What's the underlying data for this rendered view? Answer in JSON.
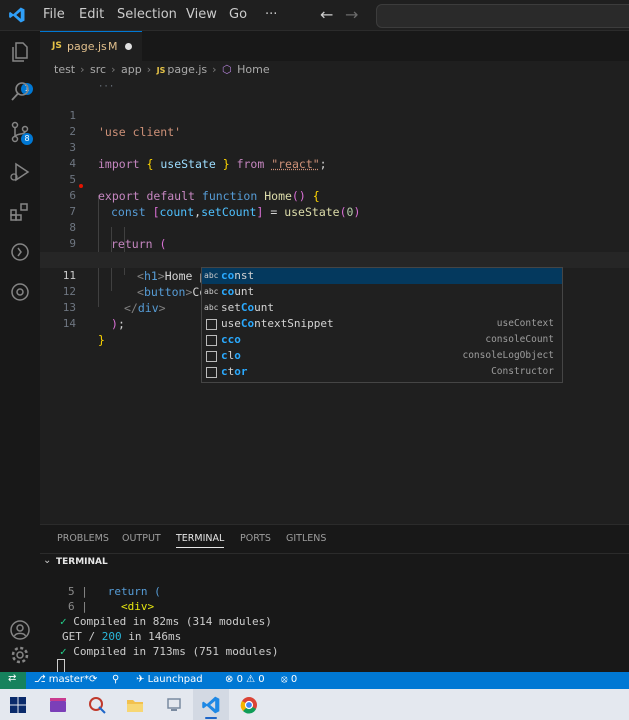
{
  "menu": [
    "File",
    "Edit",
    "Selection",
    "View",
    "Go",
    "···"
  ],
  "nav": {
    "back": "←",
    "forward": "→"
  },
  "activity_bar": {
    "scm_badge": "8",
    "explorer_badge": "1"
  },
  "tab": {
    "icon": "JS",
    "name": "page.js",
    "status": "M"
  },
  "breadcrumb": [
    "test",
    "src",
    "app",
    "page.js",
    "Home"
  ],
  "breadcrumb_icons": {
    "file": "JS",
    "symbol": "⬡"
  },
  "editor": {
    "scroll_hint": "···",
    "line_numbers": [
      "1",
      "2",
      "3",
      "4",
      "5",
      "6",
      "7",
      "8",
      "9",
      "10",
      "11",
      "12",
      "13",
      "14"
    ],
    "active_line": "11",
    "lines": {
      "l1": "'use client'",
      "l3": [
        "import",
        "{",
        "useState",
        "}",
        "from",
        "\"react\"",
        ";"
      ],
      "l5": [
        "export",
        "default",
        "function",
        "Home",
        "()",
        "{"
      ],
      "l6": [
        "const",
        "[",
        "count",
        ",",
        "setCount",
        "]",
        "=",
        "useState",
        "(",
        "0",
        ")"
      ],
      "l8": [
        "return",
        "("
      ],
      "l9": [
        "<",
        "div",
        ">"
      ],
      "l10": [
        "<",
        "h1",
        ">",
        "Home page",
        "</",
        "h1",
        ">"
      ],
      "l11": [
        "<",
        "button",
        ">",
        "Co",
        "</",
        "button",
        ">"
      ],
      "l12": [
        "</",
        "div",
        ">"
      ],
      "l13": [
        ")",
        ";"
      ],
      "l14": [
        "}"
      ]
    }
  },
  "suggestions": [
    {
      "kind": "abc",
      "match": "co",
      "rest": "nst",
      "detail": ""
    },
    {
      "kind": "abc",
      "match": "co",
      "rest": "unt",
      "detail": ""
    },
    {
      "kind": "abc",
      "pre": "set",
      "match": "Co",
      "rest": "unt",
      "detail": ""
    },
    {
      "kind": "snippet",
      "pre": "use",
      "match": "Co",
      "rest": "ntextSnippet",
      "detail": "useContext"
    },
    {
      "kind": "snippet",
      "match": "c",
      "mid": "c",
      "rest": "o",
      "detail": "consoleCount"
    },
    {
      "kind": "snippet",
      "match": "c",
      "mid": "l",
      "rest": "o",
      "detail": "consoleLogObject"
    },
    {
      "kind": "snippet",
      "match": "c",
      "mid": "t",
      "rest": "or",
      "detail": "Constructor"
    }
  ],
  "panel_tabs": [
    "PROBLEMS",
    "OUTPUT",
    "TERMINAL",
    "PORTS",
    "GITLENS"
  ],
  "active_panel_tab": "TERMINAL",
  "terminal_header": "TERMINAL",
  "terminal": {
    "line1_num": "5",
    "line1_sep": "|",
    "line1_code": "return (",
    "line2_num": "6",
    "line2_sep": "|",
    "line2_code": "<div>",
    "compiled1": "Compiled in 82ms (314 modules)",
    "get_pre": "GET / ",
    "get_status": "200",
    "get_post": " in 146ms",
    "compiled2": "Compiled in 713ms (751 modules)",
    "check": "✓"
  },
  "status_bar": {
    "branch": "master*",
    "launchpad": "Launchpad",
    "errors": "0",
    "warnings": "0",
    "ports": "0"
  },
  "colors": {
    "accent": "#0078d4",
    "remote": "#16825d"
  }
}
